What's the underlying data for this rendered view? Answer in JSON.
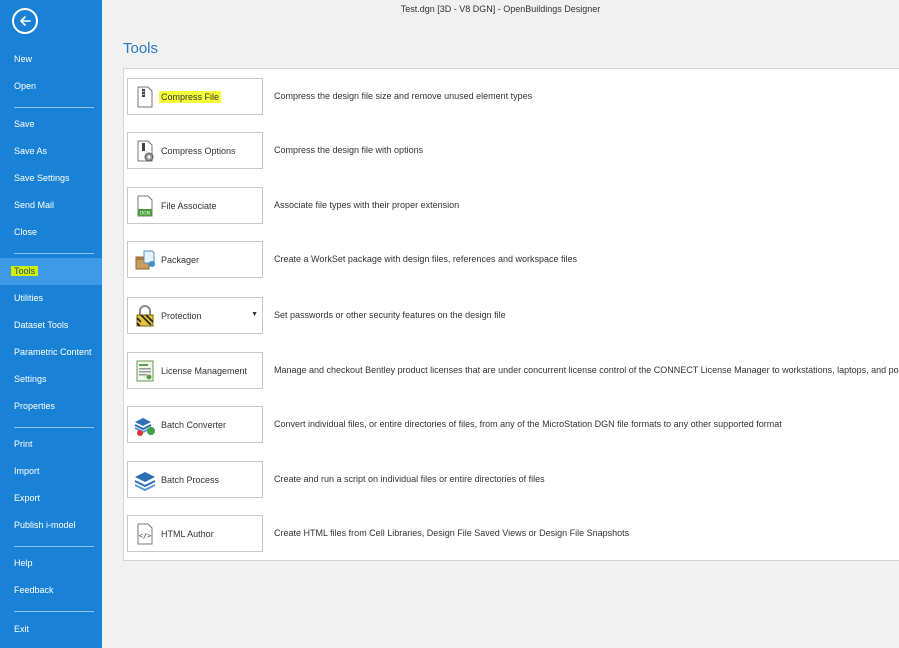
{
  "window": {
    "title": "Test.dgn [3D - V8 DGN] - OpenBuildings Designer"
  },
  "page": {
    "title": "Tools"
  },
  "sidebar": {
    "items": [
      {
        "label": "New",
        "active": false
      },
      {
        "label": "Open",
        "active": false
      },
      {
        "label": "Save",
        "active": false
      },
      {
        "label": "Save As",
        "active": false
      },
      {
        "label": "Save Settings",
        "active": false
      },
      {
        "label": "Send Mail",
        "active": false
      },
      {
        "label": "Close",
        "active": false
      },
      {
        "label": "Tools",
        "active": true
      },
      {
        "label": "Utilities",
        "active": false
      },
      {
        "label": "Dataset Tools",
        "active": false
      },
      {
        "label": "Parametric Content",
        "active": false
      },
      {
        "label": "Settings",
        "active": false
      },
      {
        "label": "Properties",
        "active": false
      },
      {
        "label": "Print",
        "active": false
      },
      {
        "label": "Import",
        "active": false
      },
      {
        "label": "Export",
        "active": false
      },
      {
        "label": "Publish i-model",
        "active": false
      },
      {
        "label": "Help",
        "active": false
      },
      {
        "label": "Feedback",
        "active": false
      },
      {
        "label": "Exit",
        "active": false
      }
    ]
  },
  "tools": [
    {
      "label": "Compress File",
      "description": "Compress the design file size and remove unused element types",
      "icon": "compress-file-icon",
      "highlighted": true
    },
    {
      "label": "Compress Options",
      "description": "Compress the design file with options",
      "icon": "compress-options-icon"
    },
    {
      "label": "File Associate",
      "description": "Associate file types with their proper extension",
      "icon": "file-associate-icon",
      "icon_text": "DGN"
    },
    {
      "label": "Packager",
      "description": "Create a WorkSet package with design files, references and workspace files",
      "icon": "packager-icon"
    },
    {
      "label": "Protection",
      "description": "Set passwords or other security features on the design file",
      "icon": "lock-icon",
      "dropdown": true
    },
    {
      "label": "License Management",
      "description": "Manage and checkout Bentley product licenses that are under concurrent license control of the CONNECT License Manager to workstations, laptops, and portables",
      "icon": "license-icon"
    },
    {
      "label": "Batch Converter",
      "description": "Convert individual files, or entire directories of files, from any of the MicroStation DGN file formats to any other supported format",
      "icon": "batch-converter-icon"
    },
    {
      "label": "Batch Process",
      "description": "Create and run a script on individual files or entire directories of files",
      "icon": "batch-process-icon"
    },
    {
      "label": "HTML Author",
      "description": "Create HTML files from Cell Libraries, Design File Saved Views or Design File Snapshots",
      "icon": "html-author-icon",
      "icon_text": "</>"
    }
  ],
  "colors": {
    "sidebar": "#1a82d6",
    "active_item": "#3d9ae6",
    "title": "#2b79c2",
    "highlight": "#f5ff3a"
  }
}
